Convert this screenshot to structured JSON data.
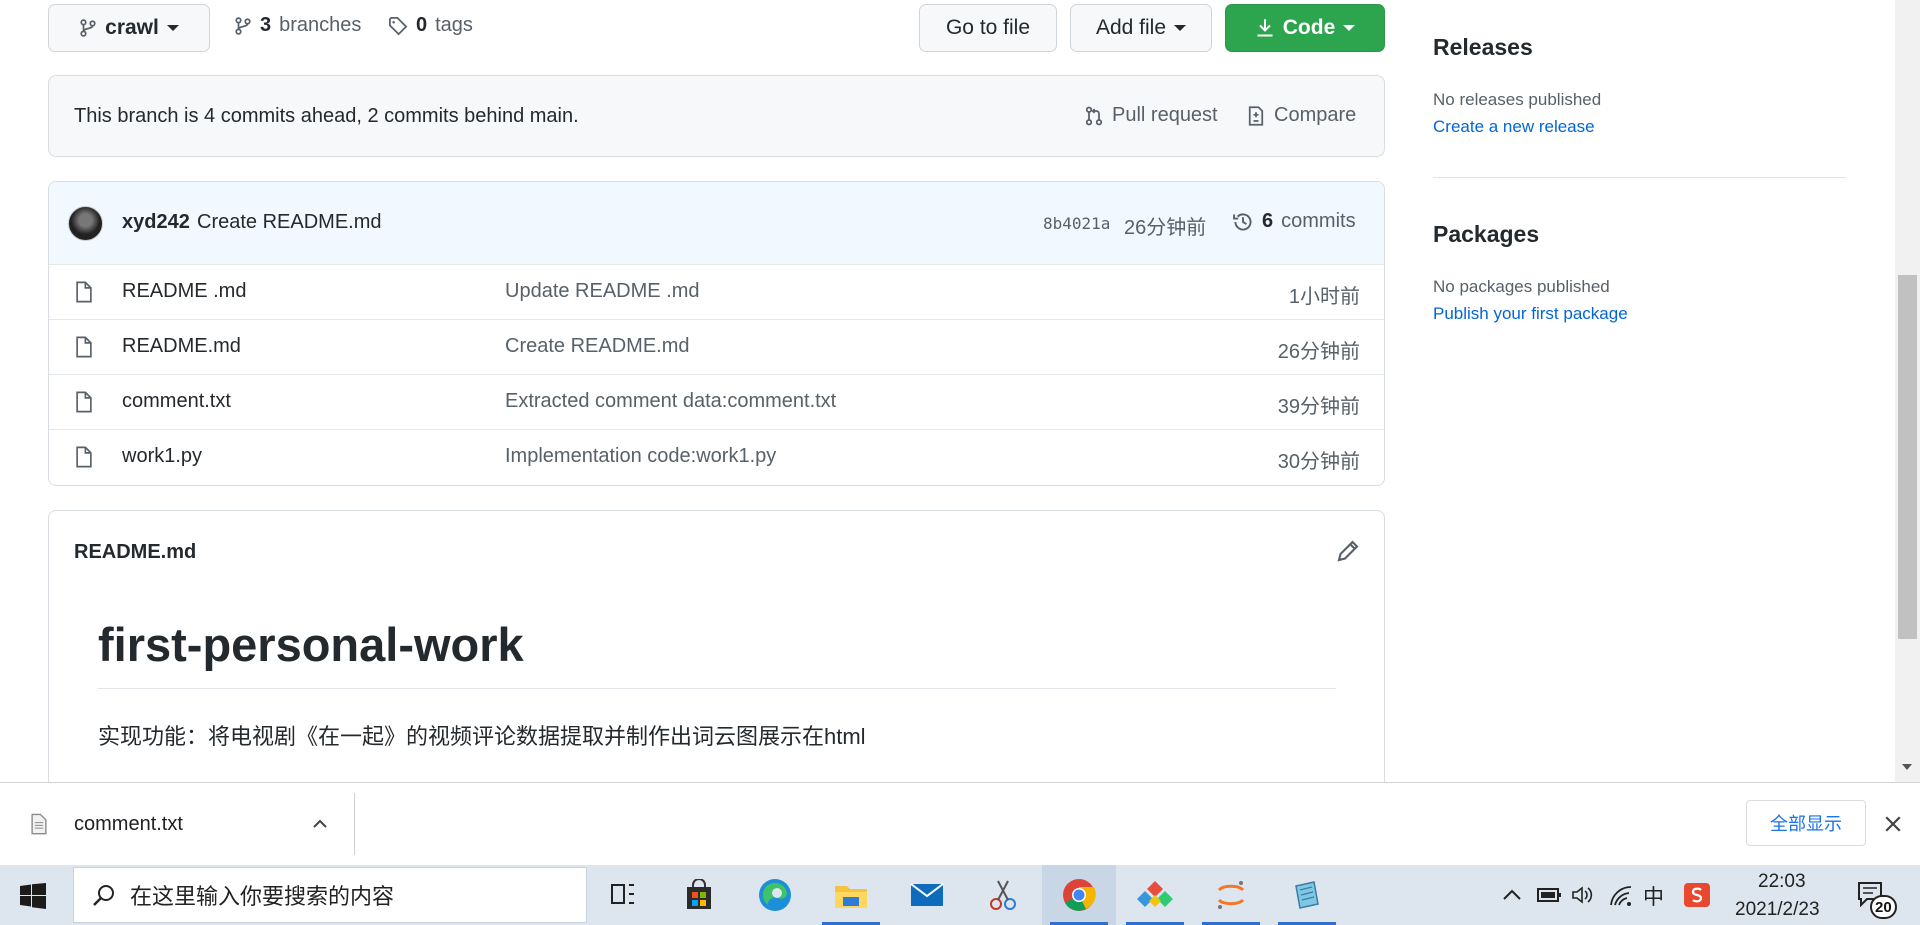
{
  "toolbar": {
    "branch_name": "crawl",
    "branches_count": "3",
    "branches_label": "branches",
    "tags_count": "0",
    "tags_label": "tags",
    "go_to_file": "Go to file",
    "add_file": "Add file",
    "code": "Code"
  },
  "branch_status": {
    "text": "This branch is 4 commits ahead, 2 commits behind main.",
    "pull_request": "Pull request",
    "compare": "Compare"
  },
  "latest_commit": {
    "author": "xyd242",
    "message": "Create README.md",
    "sha": "8b4021a",
    "time": "26分钟前",
    "commits_count": "6",
    "commits_label": "commits"
  },
  "files": [
    {
      "name": "README .md",
      "message": "Update README .md",
      "time": "1小时前"
    },
    {
      "name": "README.md",
      "message": "Create README.md",
      "time": "26分钟前"
    },
    {
      "name": "comment.txt",
      "message": "Extracted comment data:comment.txt",
      "time": "39分钟前"
    },
    {
      "name": "work1.py",
      "message": "Implementation code:work1.py",
      "time": "30分钟前"
    }
  ],
  "readme": {
    "filename": "README.md",
    "heading": "first-personal-work",
    "body": "实现功能：将电视剧《在一起》的视频评论数据提取并制作出词云图展示在html"
  },
  "sidebar": {
    "releases_title": "Releases",
    "releases_text": "No releases published",
    "releases_link": "Create a new release",
    "packages_title": "Packages",
    "packages_text": "No packages published",
    "packages_link": "Publish your first package"
  },
  "download_bar": {
    "file_name": "comment.txt",
    "show_all": "全部显示"
  },
  "taskbar": {
    "search_placeholder": "在这里输入你要搜索的内容",
    "ime": "中",
    "time": "22:03",
    "date": "2021/2/23",
    "notification_count": "20"
  },
  "colors": {
    "code_button": "#2da44e",
    "link": "#0366d6",
    "commit_header_bg": "#f1f8ff"
  }
}
